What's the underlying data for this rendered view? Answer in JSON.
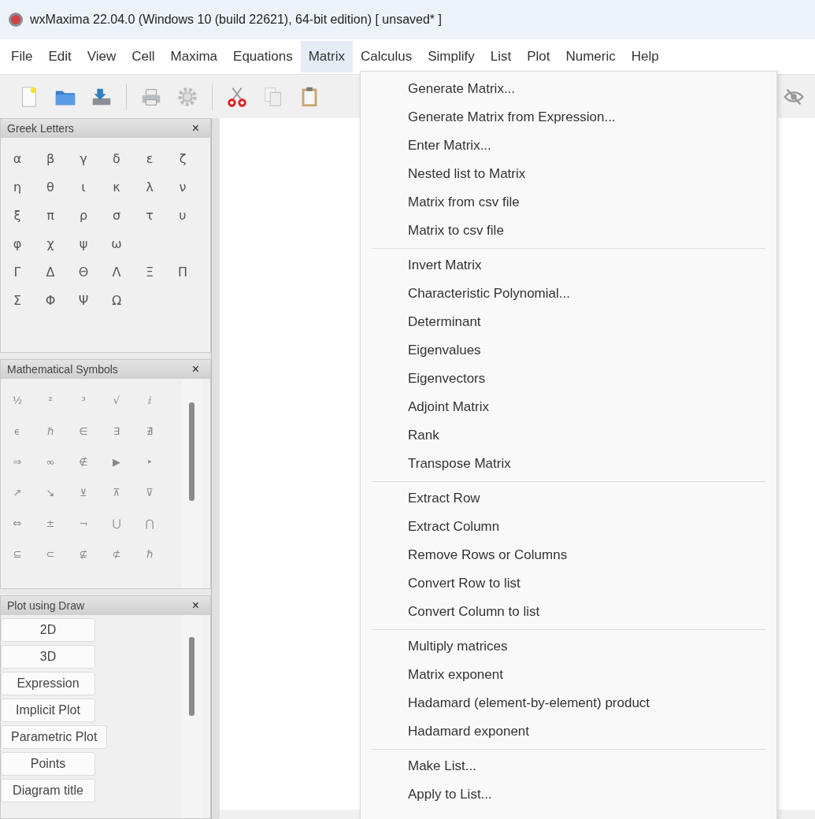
{
  "window": {
    "title": "wxMaxima 22.04.0 (Windows 10 (build 22621), 64-bit edition) [ unsaved* ]"
  },
  "menu_bar": [
    {
      "label": "File",
      "selected": false
    },
    {
      "label": "Edit",
      "selected": false
    },
    {
      "label": "View",
      "selected": false
    },
    {
      "label": "Cell",
      "selected": false
    },
    {
      "label": "Maxima",
      "selected": false
    },
    {
      "label": "Equations",
      "selected": false
    },
    {
      "label": "Matrix",
      "selected": true
    },
    {
      "label": "Calculus",
      "selected": false
    },
    {
      "label": "Simplify",
      "selected": false
    },
    {
      "label": "List",
      "selected": false
    },
    {
      "label": "Plot",
      "selected": false
    },
    {
      "label": "Numeric",
      "selected": false
    },
    {
      "label": "Help",
      "selected": false
    }
  ],
  "greek_letters": {
    "title": "Greek Letters",
    "close": "×",
    "rows": [
      [
        "α",
        "β",
        "γ",
        "δ",
        "ε",
        "ζ"
      ],
      [
        "η",
        "θ",
        "ι",
        "κ",
        "λ",
        "ν"
      ],
      [
        "ξ",
        "π",
        "ρ",
        "σ",
        "τ",
        "υ"
      ],
      [
        "φ",
        "χ",
        "ψ",
        "ω"
      ],
      [
        "Γ",
        "Δ",
        "Θ",
        "Λ",
        "Ξ",
        "Π"
      ],
      [
        "Σ",
        "Φ",
        "Ψ",
        "Ω"
      ]
    ]
  },
  "math_symbols": {
    "title": "Mathematical Symbols",
    "close": "×",
    "rows": [
      [
        "½",
        "²",
        "³",
        "√",
        "ⅈ"
      ],
      [
        "ϵ",
        "ℏ",
        "∈",
        "∃",
        "∄"
      ],
      [
        "⇒",
        "∞",
        "∉",
        "▶",
        "‣"
      ],
      [
        "↗",
        "↘",
        "⊻",
        "⊼",
        "⊽"
      ],
      [
        "⇔",
        "±",
        "¬",
        "⋃",
        "⋂"
      ],
      [
        "⊆",
        "⊂",
        "⊈",
        "⊄",
        "ℏ"
      ]
    ]
  },
  "plot_draw": {
    "title": "Plot using Draw",
    "close": "×",
    "buttons": [
      "2D",
      "3D",
      "Expression",
      "Implicit Plot",
      "Parametric Plot",
      "Points",
      "Diagram title"
    ]
  },
  "matrix_menu": {
    "groups": [
      [
        "Generate Matrix...",
        "Generate Matrix from Expression...",
        "Enter Matrix...",
        "Nested list to Matrix",
        "Matrix from csv file",
        "Matrix to csv file"
      ],
      [
        "Invert Matrix",
        "Characteristic Polynomial...",
        "Determinant",
        "Eigenvalues",
        "Eigenvectors",
        "Adjoint Matrix",
        "Rank",
        "Transpose Matrix"
      ],
      [
        "Extract Row",
        "Extract Column",
        "Remove Rows or Columns",
        "Convert Row to list",
        "Convert Column to list"
      ],
      [
        "Multiply matrices",
        "Matrix exponent",
        "Hadamard (element-by-element) product",
        "Hadamard exponent"
      ],
      [
        "Make List...",
        "Apply to List..."
      ]
    ]
  }
}
